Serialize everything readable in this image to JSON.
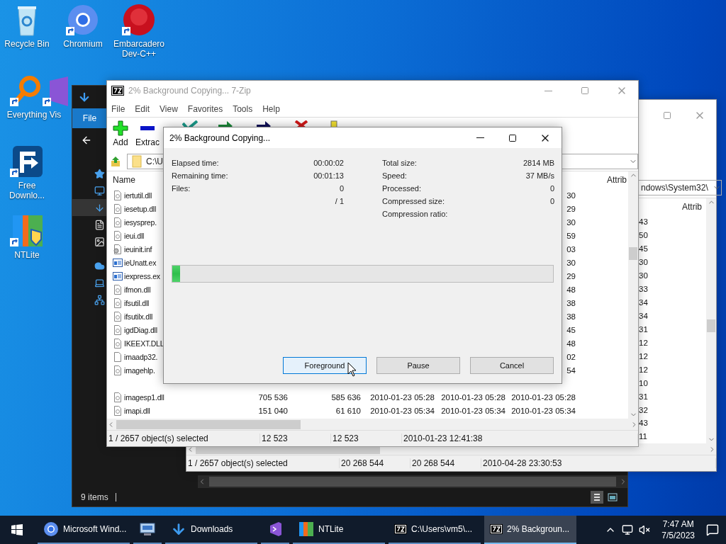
{
  "desktop_icons": [
    {
      "kind": "recycle",
      "label": "Recycle Bin"
    },
    {
      "kind": "chromium",
      "label": "Chromium"
    },
    {
      "kind": "devcpp",
      "label": "Embarcadero Dev-C++"
    },
    {
      "kind": "everything",
      "label": "Everything"
    },
    {
      "kind": "vs",
      "label": "Vis"
    },
    {
      "kind": "fdm",
      "label": "Free Downlo..."
    },
    {
      "kind": "ntlite",
      "label": "NTLite"
    }
  ],
  "explorer": {
    "ribbon_tab": "File",
    "nav": [
      {
        "kind": "star",
        "selected": false
      },
      {
        "kind": "desktop",
        "selected": false
      },
      {
        "kind": "download",
        "selected": true
      },
      {
        "kind": "document",
        "selected": false
      },
      {
        "kind": "picture",
        "selected": false
      },
      {
        "kind": "cloud",
        "selected": false
      },
      {
        "kind": "computer",
        "selected": false
      },
      {
        "kind": "network",
        "selected": false
      }
    ],
    "status": "9 items"
  },
  "background_window": {
    "address": "ndows\\System32\\",
    "columns": [
      "Attrib"
    ],
    "rows": [
      "43",
      "50",
      "45",
      "30",
      "30",
      "33",
      "34",
      "34",
      "31",
      "12",
      "12",
      "12",
      "10",
      "31",
      "32",
      "43",
      "11"
    ],
    "status": [
      "1 / 2657 object(s) selected",
      "20 268 544",
      "20 268 544",
      "2010-04-28 23:30:53"
    ]
  },
  "main_window": {
    "title": "2% Background Copying... 7-Zip",
    "menu": [
      "File",
      "Edit",
      "View",
      "Favorites",
      "Tools",
      "Help"
    ],
    "toolbar": [
      "Add",
      "Extrac"
    ],
    "address": "C:\\U",
    "columns": [
      "Name",
      "Attrib"
    ],
    "rows": [
      {
        "kind": "dll",
        "name": "iertutil.dll",
        "tail": "30"
      },
      {
        "kind": "dll",
        "name": "iesetup.dll",
        "tail": "29"
      },
      {
        "kind": "dll",
        "name": "iesysprep.",
        "tail": "30"
      },
      {
        "kind": "dll",
        "name": "ieui.dll",
        "tail": "59"
      },
      {
        "kind": "inf",
        "name": "ieuinit.inf",
        "tail": "03"
      },
      {
        "kind": "exe",
        "name": "ieUnatt.ex",
        "tail": "30"
      },
      {
        "kind": "exe",
        "name": "iexpress.ex",
        "tail": "29"
      },
      {
        "kind": "dll",
        "name": "ifmon.dll",
        "tail": "48"
      },
      {
        "kind": "dll",
        "name": "ifsutil.dll",
        "tail": "38"
      },
      {
        "kind": "dll",
        "name": "ifsutilx.dll",
        "tail": "38"
      },
      {
        "kind": "dll",
        "name": "igdDiag.dll",
        "tail": "45"
      },
      {
        "kind": "dll",
        "name": "IKEEXT.DLL",
        "tail": "48"
      },
      {
        "kind": "blank",
        "name": "imaadp32.",
        "tail": "02"
      },
      {
        "kind": "dll",
        "name": "imagehlp.",
        "tail": "54"
      },
      {
        "kind": "dll",
        "name": "imagesp1.dll",
        "unpacked": "705 536",
        "packed": "585 636",
        "modified": "2010-01-23 05:28",
        "created": "2010-01-23 05:28",
        "accessed": "2010-01-23 05:28"
      },
      {
        "kind": "dll",
        "name": "imapi.dll",
        "unpacked": "151 040",
        "packed": "61 610",
        "modified": "2010-01-23 05:34",
        "created": "2010-01-23 05:34",
        "accessed": "2010-01-23 05:34"
      }
    ],
    "status": [
      "1 / 2657 object(s) selected",
      "12 523",
      "12 523",
      "2010-01-23 12:41:38"
    ]
  },
  "dialog": {
    "title": "2% Background Copying...",
    "stats_left": [
      {
        "label": "Elapsed time:",
        "value": "00:00:02"
      },
      {
        "label": "Remaining time:",
        "value": "00:01:13"
      },
      {
        "label": "Files:",
        "value": "0"
      },
      {
        "value": "/ 1"
      }
    ],
    "stats_right": [
      {
        "label": "Total size:",
        "value": "2814 MB"
      },
      {
        "label": "Speed:",
        "value": "37 MB/s"
      },
      {
        "label": "Processed:",
        "value": "0"
      },
      {
        "label": "Compressed size:",
        "value": "0"
      },
      {
        "label": "Compression ratio:"
      }
    ],
    "progress": {
      "level": 0.02
    },
    "buttons": [
      {
        "label": "Foreground",
        "selected": true
      },
      {
        "label": "Pause",
        "selected": false
      },
      {
        "label": "Cancel",
        "selected": false
      }
    ]
  },
  "taskbar": {
    "items": [
      {
        "kind": "chromium",
        "label": "Microsoft Wind...",
        "selected": false
      },
      {
        "kind": "control-panel",
        "selected": false
      },
      {
        "kind": "downloads",
        "label": "Downloads",
        "selected": false
      },
      {
        "kind": "vs",
        "selected": false
      },
      {
        "kind": "ntlite",
        "label": "NTLite",
        "selected": false
      },
      {
        "kind": "sevenzip",
        "label": "C:\\Users\\vm5\\...",
        "selected": false
      },
      {
        "kind": "sevenzip",
        "label": "2% Backgroun...",
        "selected": true
      }
    ],
    "time": "7:47 AM",
    "date": "7/5/2023"
  }
}
